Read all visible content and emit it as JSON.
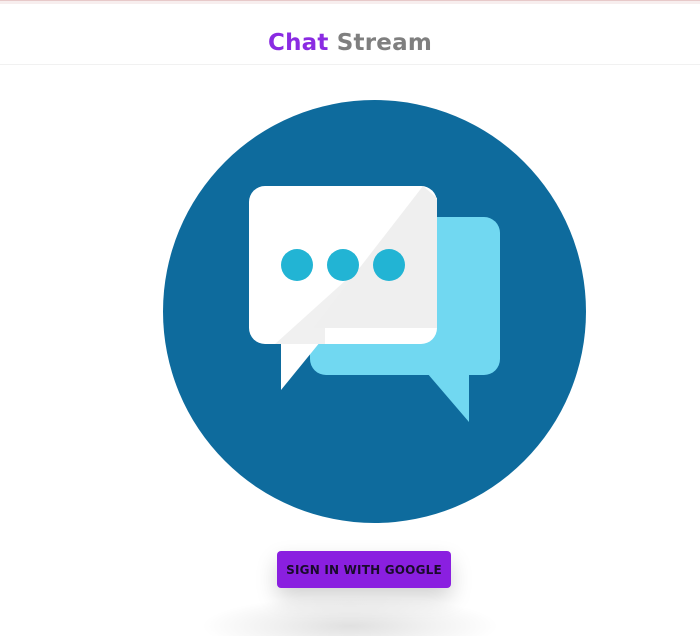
{
  "header": {
    "brand_part1": "Chat",
    "brand_part2": "Stream"
  },
  "hero": {
    "icon": "chat-bubbles-icon"
  },
  "auth": {
    "signin_label": "SIGN IN WITH GOOGLE"
  },
  "colors": {
    "brand_purple": "#8a2be2",
    "brand_gray": "#7f7f7f",
    "circle_blue": "#0e6b9d",
    "bubble_light_blue": "#71d8f1",
    "dot_blue": "#22b4d4",
    "button_purple": "#8a1fe0"
  }
}
